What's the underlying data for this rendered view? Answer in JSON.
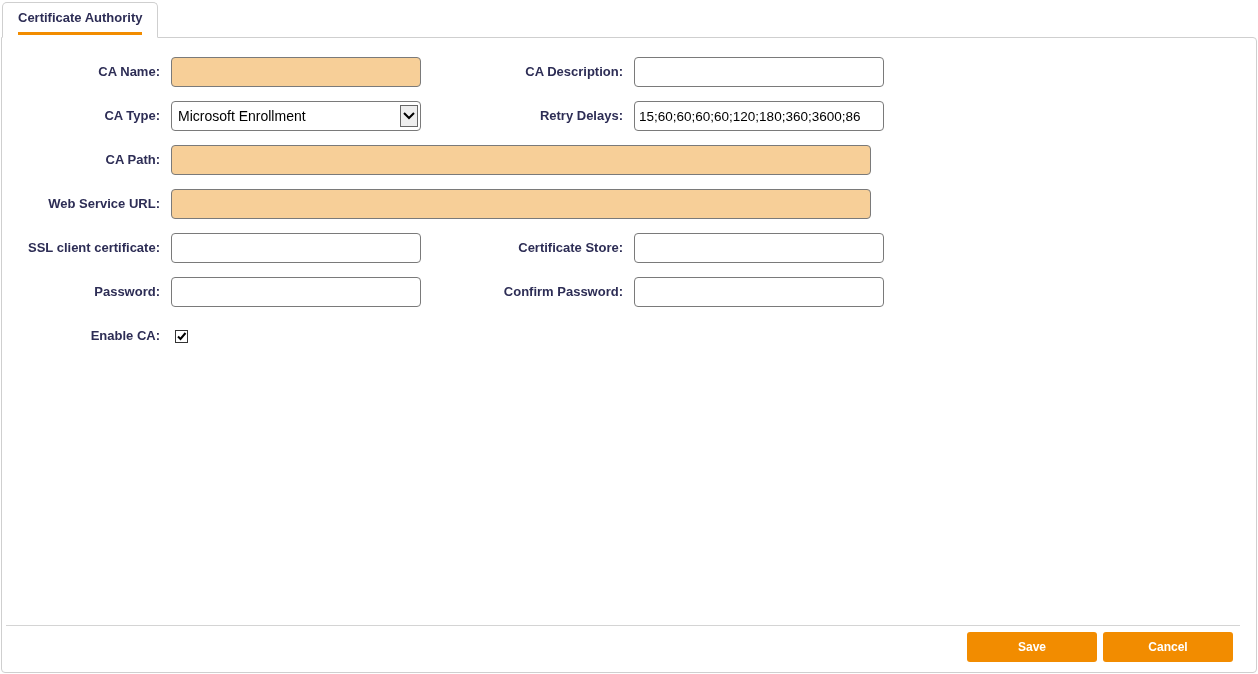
{
  "tabs": [
    {
      "label": "Certificate Authority",
      "selected": true
    }
  ],
  "rows": [
    {
      "kind": "pair",
      "fields": [
        {
          "label": "CA Name:",
          "required": true
        },
        {
          "label": "CA Description:",
          "required": false
        }
      ]
    },
    {
      "kind": "pair",
      "fields": [
        {
          "label": "CA Type:",
          "kind": "select",
          "value": "Microsoft Enrollment"
        },
        {
          "label": "Retry Delays:",
          "required": false,
          "value": "15;60;60;60;60;120;180;360;3600;86"
        }
      ]
    },
    {
      "kind": "wide",
      "fields": [
        {
          "label": "CA Path:",
          "required": true
        }
      ]
    },
    {
      "kind": "wide",
      "fields": [
        {
          "label": "Web Service URL:",
          "required": true
        }
      ]
    },
    {
      "kind": "pair",
      "fields": [
        {
          "label": "SSL client certificate:",
          "required": false
        },
        {
          "label": "Certificate Store:",
          "required": false
        }
      ]
    },
    {
      "kind": "pair",
      "fields": [
        {
          "label": "Password:",
          "required": false
        },
        {
          "label": "Confirm Password:",
          "required": false
        }
      ]
    },
    {
      "kind": "checkbox",
      "fields": [
        {
          "label": "Enable CA:",
          "checked": true
        }
      ]
    }
  ],
  "buttons": [
    "Save",
    "Cancel"
  ]
}
